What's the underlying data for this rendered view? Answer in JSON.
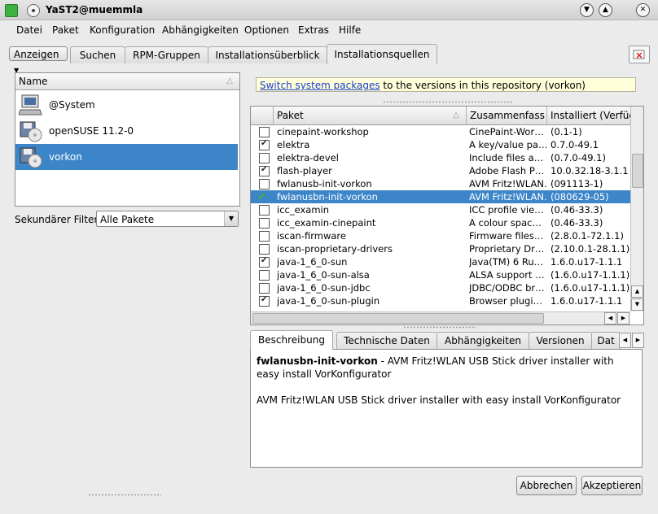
{
  "window": {
    "title": "YaST2@muemmla"
  },
  "menu": [
    "Datei",
    "Paket",
    "Konfiguration",
    "Abhängigkeiten",
    "Optionen",
    "Extras",
    "Hilfe"
  ],
  "view_button": "Anzeigen",
  "tabs": [
    "Suchen",
    "RPM-Gruppen",
    "Installationsüberblick",
    "Installationsquellen"
  ],
  "repos": {
    "header": "Name",
    "items": [
      {
        "label": "@System",
        "icon": "computer-icon"
      },
      {
        "label": "openSUSE 11.2-0",
        "icon": "disk-icon"
      },
      {
        "label": "vorkon",
        "icon": "disk-icon",
        "selected": true
      }
    ]
  },
  "filter": {
    "label": "Sekundärer Filter:",
    "value": "Alle Pakete"
  },
  "notice": {
    "link": "Switch system packages",
    "text": " to the versions in this repository (vorkon)"
  },
  "packages": {
    "columns": [
      "Paket",
      "Zusammenfass",
      "Installiert (Verfüg"
    ],
    "rows": [
      {
        "name": "cinepaint-workshop",
        "summary": "CinePaint-Wor…",
        "installed": "(0.1-1)",
        "checked": false
      },
      {
        "name": "elektra",
        "summary": "A key/value pa…",
        "installed": "0.7.0-49.1",
        "checked": true
      },
      {
        "name": "elektra-devel",
        "summary": "Include files a…",
        "installed": "(0.7.0-49.1)",
        "checked": false
      },
      {
        "name": "flash-player",
        "summary": "Adobe Flash P…",
        "installed": "10.0.32.18-3.1.1",
        "checked": true
      },
      {
        "name": "fwlanusb-init-vorkon",
        "summary": "AVM Fritz!WLAN…",
        "installed": "(091113-1)",
        "checked": false
      },
      {
        "name": "fwlanusbn-init-vorkon",
        "summary": "AVM Fritz!WLAN…",
        "installed": "(080629-05)",
        "checked": true,
        "selected": true
      },
      {
        "name": "icc_examin",
        "summary": "ICC profile vie…",
        "installed": "(0.46-33.3)",
        "checked": false
      },
      {
        "name": "icc_examin-cinepaint",
        "summary": "A colour spac…",
        "installed": "(0.46-33.3)",
        "checked": false
      },
      {
        "name": "iscan-firmware",
        "summary": "Firmware files…",
        "installed": "(2.8.0.1-72.1.1)",
        "checked": false
      },
      {
        "name": "iscan-proprietary-drivers",
        "summary": "Proprietary Dr…",
        "installed": "(2.10.0.1-28.1.1)",
        "checked": false
      },
      {
        "name": "java-1_6_0-sun",
        "summary": "Java(TM) 6 Ru…",
        "installed": "1.6.0.u17-1.1.1",
        "checked": true
      },
      {
        "name": "java-1_6_0-sun-alsa",
        "summary": "ALSA support …",
        "installed": "(1.6.0.u17-1.1.1)",
        "checked": false
      },
      {
        "name": "java-1_6_0-sun-jdbc",
        "summary": "JDBC/ODBC br…",
        "installed": "(1.6.0.u17-1.1.1)",
        "checked": false
      },
      {
        "name": "java-1_6_0-sun-plugin",
        "summary": "Browser plugi…",
        "installed": "1.6.0.u17-1.1.1",
        "checked": true
      }
    ]
  },
  "detail_tabs": [
    "Beschreibung",
    "Technische Daten",
    "Abhängigkeiten",
    "Versionen",
    "Dat"
  ],
  "description": {
    "pkg": "fwlanusbn-init-vorkon",
    "summary": " - AVM Fritz!WLAN USB Stick driver installer with easy install VorKonfigurator",
    "body": "AVM Fritz!WLAN USB Stick driver installer with easy install VorKonfigurator"
  },
  "buttons": {
    "cancel": "Abbrechen",
    "accept": "Akzeptieren"
  },
  "colors": {
    "selection": "#3c85c9",
    "link": "#1a3fcf",
    "notice_bg": "#ffffd9"
  }
}
